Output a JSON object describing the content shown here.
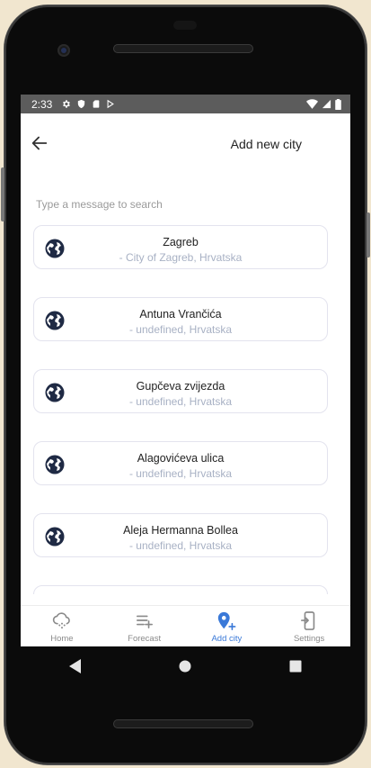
{
  "status_bar": {
    "time": "2:33",
    "left_icons": [
      "gear-icon",
      "shield-icon",
      "sd-card-icon",
      "play-store-icon"
    ],
    "right_icons": [
      "wifi-icon",
      "signal-icon",
      "battery-icon"
    ]
  },
  "header": {
    "back_icon": "arrow-left-icon",
    "title": "Add new city"
  },
  "search": {
    "placeholder": "Type a message to search",
    "value": ""
  },
  "results": [
    {
      "name": "Zagreb",
      "subtitle": "-  City of Zagreb, Hrvatska"
    },
    {
      "name": "Antuna Vrančića",
      "subtitle": "-  undefined, Hrvatska"
    },
    {
      "name": "Gupčeva zvijezda",
      "subtitle": "-  undefined, Hrvatska"
    },
    {
      "name": "Alagovićeva ulica",
      "subtitle": "-  undefined, Hrvatska"
    },
    {
      "name": "Aleja Hermanna Bollea",
      "subtitle": "-  undefined, Hrvatska"
    },
    {
      "name": "",
      "subtitle": ""
    }
  ],
  "tabs": [
    {
      "label": "Home",
      "icon": "cloud-icon",
      "active": false
    },
    {
      "label": "Forecast",
      "icon": "playlist-add-icon",
      "active": false
    },
    {
      "label": "Add city",
      "icon": "add-location-icon",
      "active": true
    },
    {
      "label": "Settings",
      "icon": "settings-phone-icon",
      "active": false
    }
  ],
  "colors": {
    "accent": "#3a79d8",
    "status_bar": "#5c5c5c",
    "inactive_tab": "#8a8a8a",
    "subtitle": "#a8b1c4",
    "card_border": "#e3e3ee"
  }
}
